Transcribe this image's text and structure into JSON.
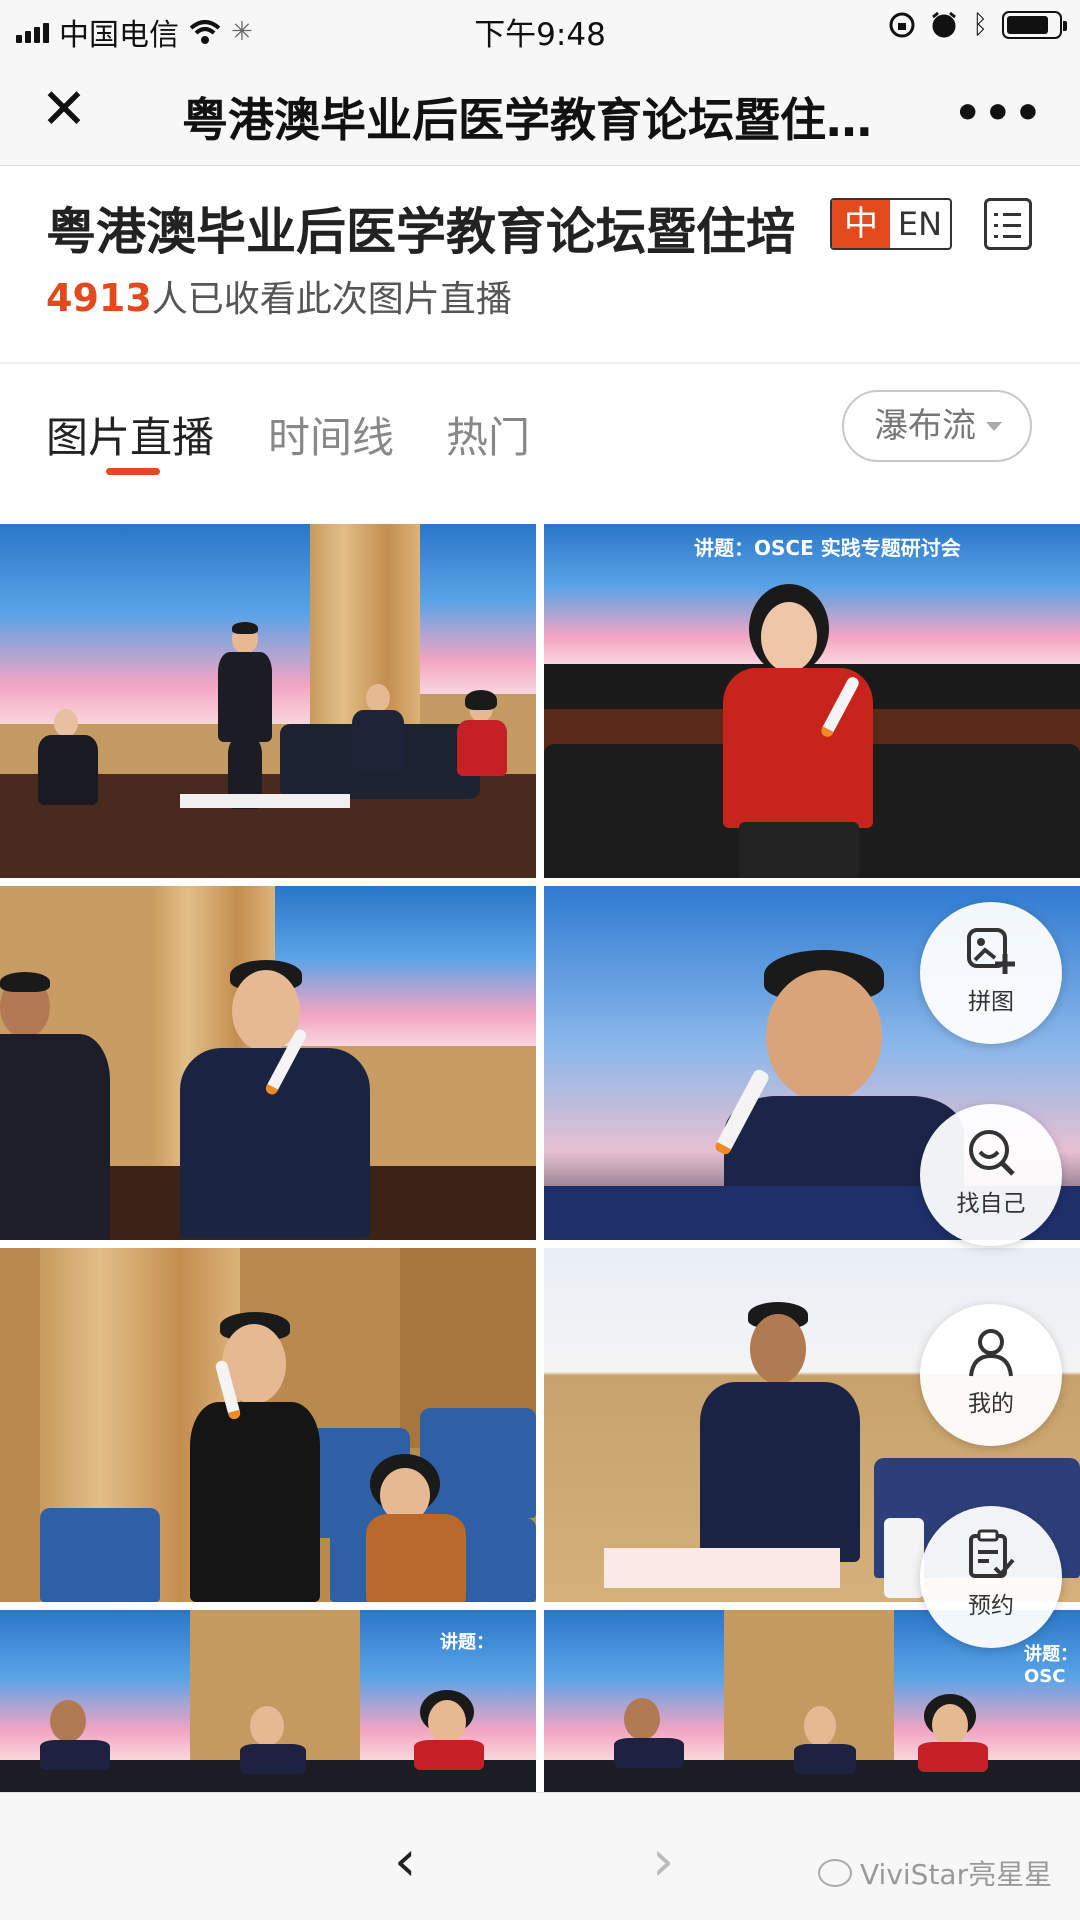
{
  "status_bar": {
    "carrier": "中国电信",
    "time": "下午9:48"
  },
  "nav": {
    "title": "粤港澳毕业后医学教育论坛暨住…"
  },
  "header": {
    "title": "粤港澳毕业后医学教育论坛暨住培",
    "lang_zh": "中",
    "lang_en": "EN",
    "view_count": "4913",
    "view_suffix": "人已收看此次图片直播"
  },
  "tabs": [
    {
      "label": "图片直播",
      "active": true
    },
    {
      "label": "时间线",
      "active": false
    },
    {
      "label": "热门",
      "active": false
    }
  ],
  "layout_select": {
    "value": "瀑布流"
  },
  "photos": [
    {
      "screen_text": ""
    },
    {
      "screen_text": "讲题：OSCE 实践专题研讨会"
    },
    {
      "screen_text": ""
    },
    {
      "screen_text": ""
    },
    {
      "screen_text": ""
    },
    {
      "screen_text": ""
    },
    {
      "screen_text": "讲题："
    },
    {
      "screen_text": "讲题：OSC"
    }
  ],
  "floating_actions": [
    {
      "label": "拼图",
      "icon": "puzzle-add-icon"
    },
    {
      "label": "找自己",
      "icon": "face-search-icon"
    },
    {
      "label": "我的",
      "icon": "person-icon"
    },
    {
      "label": "预约",
      "icon": "reservation-icon"
    }
  ],
  "bottom_bar": {
    "back": "‹",
    "forward": "›",
    "watermark": "ViviStar亮星星"
  },
  "colors": {
    "accent": "#e24a1e",
    "bar_bg": "#f7f7f7"
  }
}
